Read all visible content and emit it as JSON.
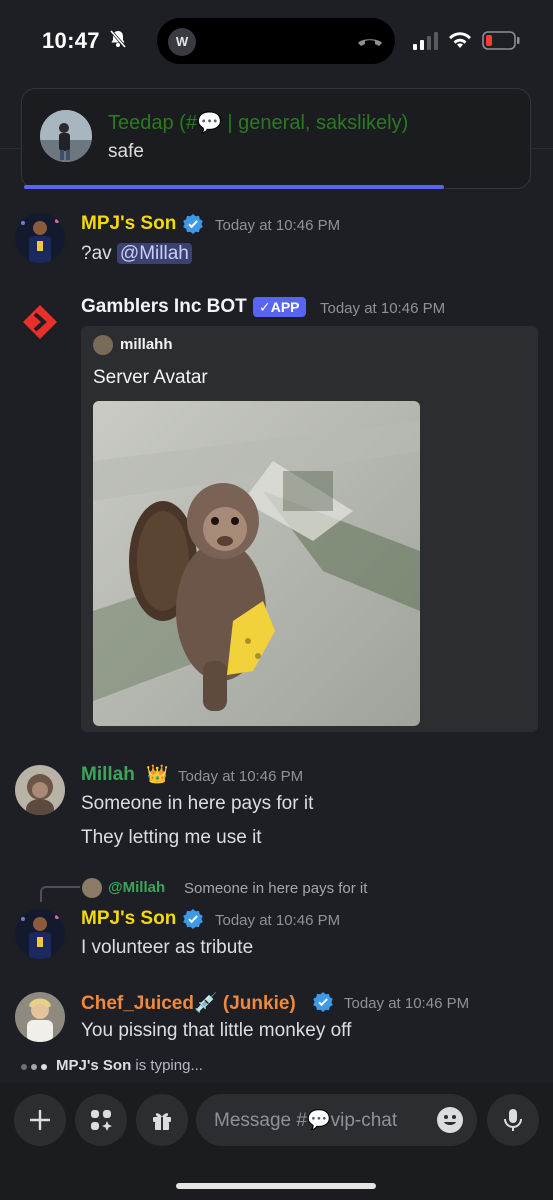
{
  "status_bar": {
    "time": "10:47",
    "island_avatar_letter": "W"
  },
  "notification": {
    "title": "Teedap (#💬 | general, sakslikely)",
    "body": "safe"
  },
  "messages": [
    {
      "author": "MPJ's Son",
      "author_color": "#f5d90a",
      "verified": true,
      "timestamp": "Today at 10:46 PM",
      "prefix": "?av ",
      "mention": "@Millah"
    },
    {
      "author": "Gamblers Inc BOT",
      "author_color": "#f2f3f5",
      "badge": "✓APP",
      "timestamp": "Today at 10:46 PM",
      "embed": {
        "author": "millahh",
        "title": "Server Avatar"
      }
    },
    {
      "author": "Millah",
      "author_color": "#3ba55c",
      "crown": "👑",
      "timestamp": "Today at 10:46 PM",
      "lines": [
        "Someone in here pays for it",
        "They letting me use it"
      ]
    },
    {
      "reply": {
        "mention": "@Millah",
        "text": "Someone in here pays for it"
      },
      "author": "MPJ's Son",
      "author_color": "#f5d90a",
      "verified": true,
      "timestamp": "Today at 10:46 PM",
      "text": "I volunteer as tribute"
    },
    {
      "author": "Chef_Juiced💉 (Junkie)",
      "author_color": "#f0883e",
      "verified": true,
      "timestamp": "Today at 10:46 PM",
      "text": "You pissing that little monkey off"
    }
  ],
  "typing": {
    "user": "MPJ's Son",
    "suffix": " is typing..."
  },
  "composer": {
    "placeholder": "Message #💬vip-chat"
  },
  "colors": {
    "background": "#1e1f24",
    "blurple": "#5865f2",
    "input_bg": "#2b2d31"
  }
}
